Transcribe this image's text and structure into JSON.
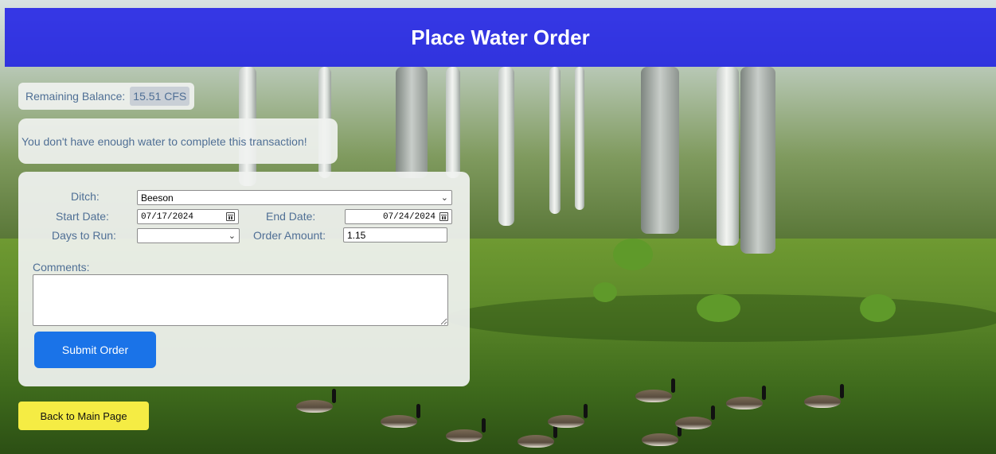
{
  "header": {
    "title": "Place Water Order"
  },
  "balance": {
    "label": "Remaining Balance:",
    "value": "15.51 CFS"
  },
  "message": {
    "text": "You don't have enough water to complete this transaction!"
  },
  "form": {
    "ditch": {
      "label": "Ditch:",
      "value": "Beeson"
    },
    "start_date": {
      "label": "Start Date:",
      "value": "07/17/2024"
    },
    "end_date": {
      "label": "End Date:",
      "value": "07/24/2024"
    },
    "days_to_run": {
      "label": "Days to Run:",
      "value": ""
    },
    "order_amount": {
      "label": "Order Amount:",
      "value": "1.15"
    },
    "comments": {
      "label": "Comments:",
      "value": ""
    },
    "submit_label": "Submit Order"
  },
  "back_label": "Back to Main Page",
  "colors": {
    "header": "#1212e6",
    "submit": "#1a73e8",
    "back": "#f5ec44",
    "label_text": "#4f6f95"
  },
  "icons": {
    "calendar": "calendar-icon",
    "dropdown": "chevron-down-icon"
  }
}
